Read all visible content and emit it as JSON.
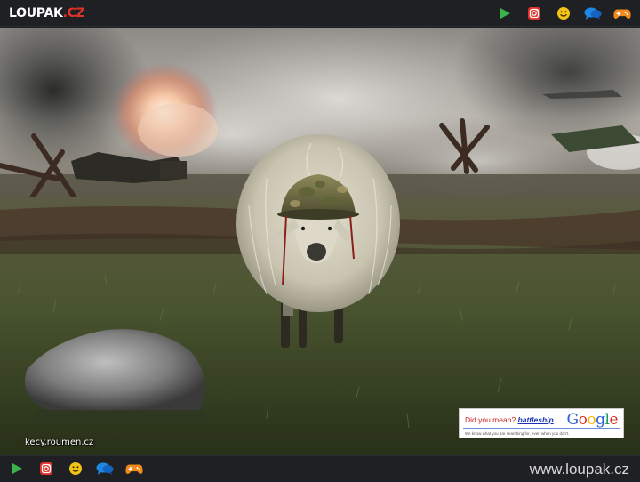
{
  "header": {
    "logo_main": "LOUPAK",
    "logo_tld": ".CZ",
    "icons": [
      "play-icon",
      "instagram-icon",
      "smiley-icon",
      "chat-icon",
      "gamepad-icon"
    ]
  },
  "photo": {
    "watermark": "kecy.roumen.cz",
    "ad": {
      "did_you_mean": "Did you mean?",
      "term": "battleship",
      "logo": "Google",
      "tagline": "We know what you are searching for, even when you don't."
    }
  },
  "footer": {
    "icons": [
      "play-icon",
      "instagram-icon",
      "smiley-icon",
      "chat-icon",
      "gamepad-icon"
    ],
    "site_url": "www.loupak.cz"
  },
  "colors": {
    "bar_bg": "#1f2024",
    "play": "#3bb34a",
    "instagram": "#e0322b",
    "smiley": "#f2c418",
    "chat": "#1e88e5",
    "gamepad": "#f08a1c"
  }
}
